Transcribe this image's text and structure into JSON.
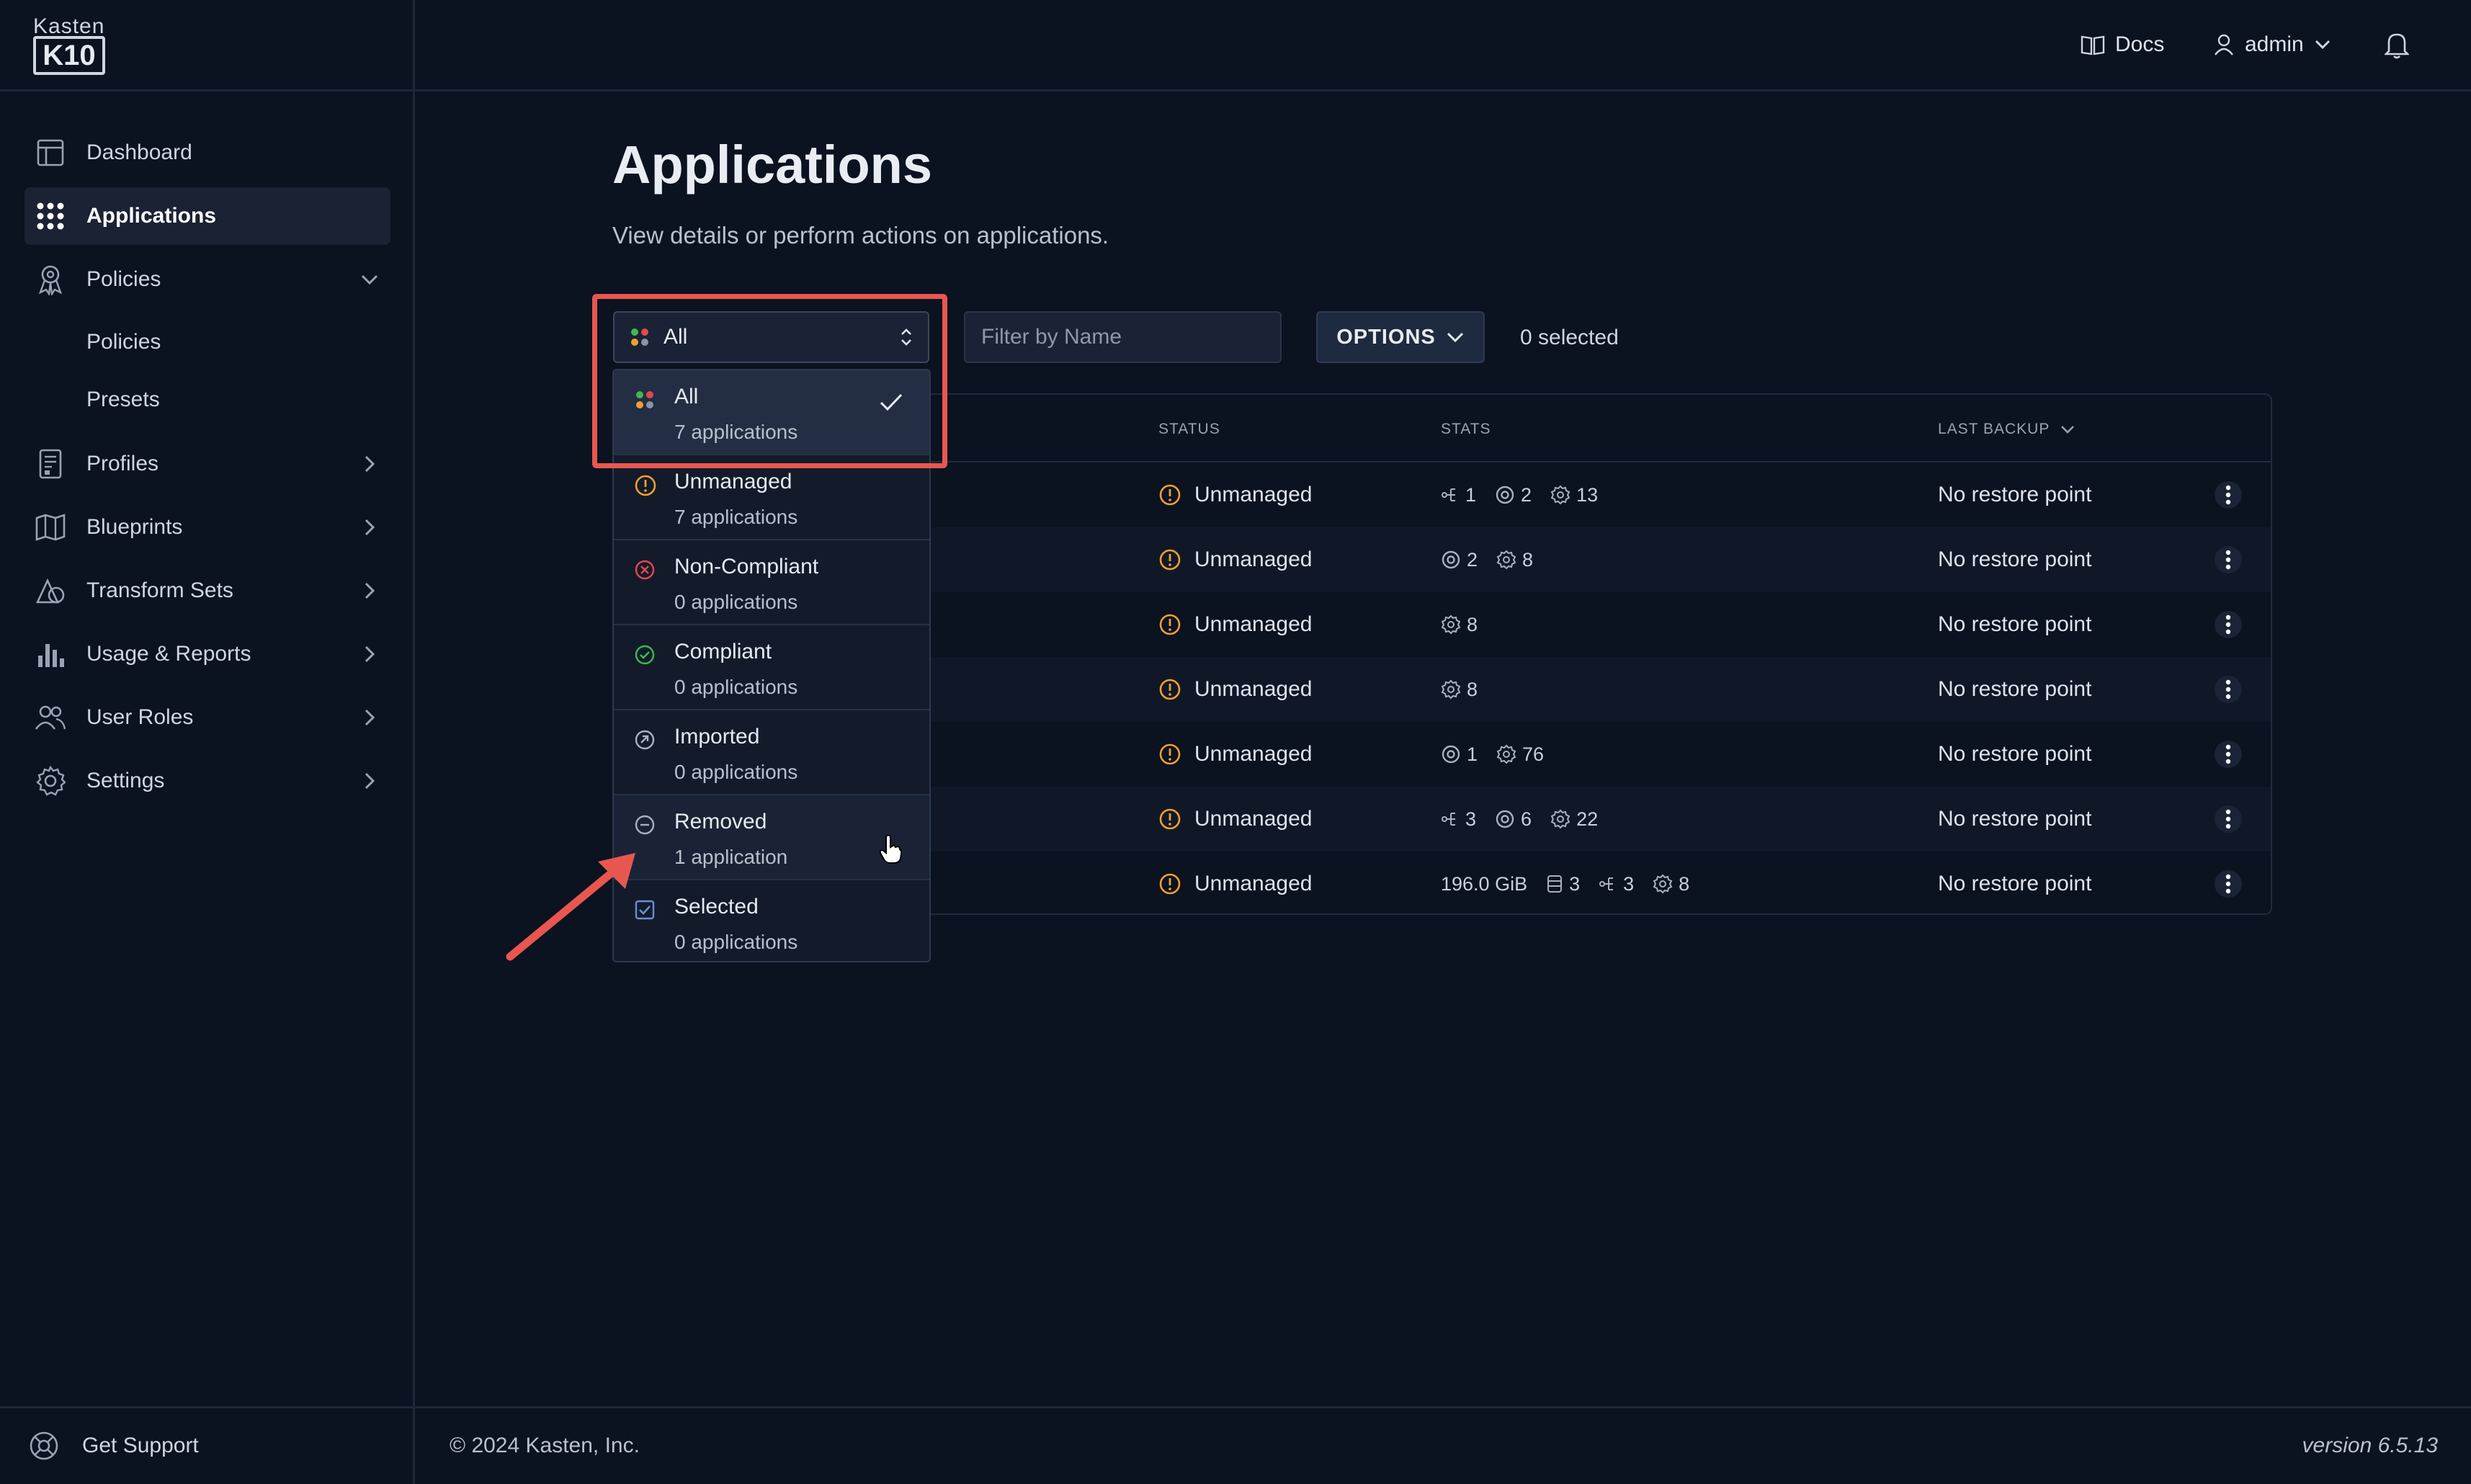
{
  "brand": {
    "small": "Kasten",
    "box": "K10"
  },
  "topbar": {
    "docs": "Docs",
    "user": "admin"
  },
  "sidebar": {
    "items": [
      {
        "label": "Dashboard",
        "icon": "dashboard-icon"
      },
      {
        "label": "Applications",
        "icon": "grid-icon",
        "active": true
      },
      {
        "label": "Policies",
        "icon": "policy-ribbon-icon",
        "expanded": true
      },
      {
        "label": "Profiles",
        "icon": "profile-doc-icon"
      },
      {
        "label": "Blueprints",
        "icon": "map-icon"
      },
      {
        "label": "Transform Sets",
        "icon": "shapes-icon"
      },
      {
        "label": "Usage & Reports",
        "icon": "bar-chart-icon"
      },
      {
        "label": "User Roles",
        "icon": "users-icon"
      },
      {
        "label": "Settings",
        "icon": "gear-icon"
      }
    ],
    "policies_children": [
      "Policies",
      "Presets"
    ],
    "support": "Get Support"
  },
  "page": {
    "title": "Applications",
    "subtitle": "View details or perform actions on applications."
  },
  "toolbar": {
    "filter_value": "All",
    "name_placeholder": "Filter by Name",
    "options_label": "OPTIONS",
    "selected_count": "0 selected"
  },
  "table": {
    "headers": {
      "status": "STATUS",
      "stats": "STATS",
      "last_backup": "LAST BACKUP"
    },
    "rows": [
      {
        "status": "Unmanaged",
        "stats": [
          {
            "icon": "network-icon",
            "value": "1"
          },
          {
            "icon": "disk-gear-icon",
            "value": "2"
          },
          {
            "icon": "cog-icon",
            "value": "13"
          }
        ],
        "last_backup": "No restore point"
      },
      {
        "status": "Unmanaged",
        "stats": [
          {
            "icon": "disk-gear-icon",
            "value": "2"
          },
          {
            "icon": "cog-icon",
            "value": "8"
          }
        ],
        "last_backup": "No restore point"
      },
      {
        "status": "Unmanaged",
        "stats": [
          {
            "icon": "cog-icon",
            "value": "8"
          }
        ],
        "last_backup": "No restore point"
      },
      {
        "status": "Unmanaged",
        "stats": [
          {
            "icon": "cog-icon",
            "value": "8"
          }
        ],
        "last_backup": "No restore point"
      },
      {
        "status": "Unmanaged",
        "stats": [
          {
            "icon": "disk-gear-icon",
            "value": "1"
          },
          {
            "icon": "cog-icon",
            "value": "76"
          }
        ],
        "last_backup": "No restore point"
      },
      {
        "status": "Unmanaged",
        "stats": [
          {
            "icon": "network-icon",
            "value": "3"
          },
          {
            "icon": "disk-gear-icon",
            "value": "6"
          },
          {
            "icon": "cog-icon",
            "value": "22"
          }
        ],
        "last_backup": "No restore point"
      },
      {
        "status": "Unmanaged",
        "stats": [
          {
            "icon": "none",
            "value": "196.0 GiB"
          },
          {
            "icon": "database-icon",
            "value": "3"
          },
          {
            "icon": "network-icon",
            "value": "3"
          },
          {
            "icon": "cog-icon",
            "value": "8"
          }
        ],
        "last_backup": "No restore point"
      }
    ]
  },
  "dropdown": {
    "items": [
      {
        "label": "All",
        "count": "7 applications",
        "icon": "dots-icon",
        "selected": true
      },
      {
        "label": "Unmanaged",
        "count": "7 applications",
        "icon": "warning-circle-icon"
      },
      {
        "label": "Non-Compliant",
        "count": "0 applications",
        "icon": "x-circle-icon"
      },
      {
        "label": "Compliant",
        "count": "0 applications",
        "icon": "check-circle-icon"
      },
      {
        "label": "Imported",
        "count": "0 applications",
        "icon": "import-circle-icon"
      },
      {
        "label": "Removed",
        "count": "1 application",
        "icon": "minus-circle-icon",
        "hover": true
      },
      {
        "label": "Selected",
        "count": "0 applications",
        "icon": "checkbox-icon"
      }
    ]
  },
  "footer": {
    "copyright": "© 2024 Kasten, Inc.",
    "version": "version 6.5.13"
  },
  "colors": {
    "accent_red": "#e8574f",
    "warning": "#f0a030",
    "error": "#e5484d",
    "success": "#3fb950",
    "background": "#0b1220"
  }
}
